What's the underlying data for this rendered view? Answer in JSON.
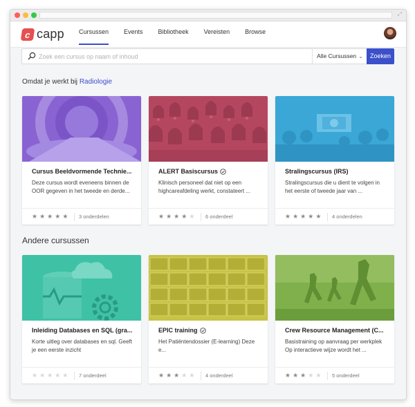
{
  "nav": {
    "logo_letter": "c",
    "logo_text": "capp",
    "items": [
      {
        "label": "Cursussen",
        "active": true
      },
      {
        "label": "Events",
        "active": false
      },
      {
        "label": "Bibliotheek",
        "active": false
      },
      {
        "label": "Vereisten",
        "active": false
      },
      {
        "label": "Browse",
        "active": false
      }
    ]
  },
  "search": {
    "placeholder": "Zoek een cursus op naam of inhoud",
    "value": "",
    "filter_label": "Alle Cursussen",
    "button_label": "Zoeken"
  },
  "sections": {
    "recommended_prefix": "Omdat je werkt bij",
    "recommended_link": "Radiologie",
    "other_title": "Andere cursussen"
  },
  "colors": {
    "accent": "#3b4bcc",
    "brand": "#e6504f"
  },
  "courses": [
    {
      "title": "Cursus Beeldvormende Technie...",
      "verified": false,
      "desc": "Deze cursus wordt eveneens binnen de OOR gegeven in het tweede en derde...",
      "rating": 5,
      "count": "3 onderdelen",
      "image": "mri-scanner",
      "tint": "#8a63d2"
    },
    {
      "title": "ALERT Basiscursus",
      "verified": true,
      "desc": "Klinisch personeel dat niet op een highcareafdeling werkt, constateert ...",
      "rating": 4,
      "count": "6 onderdeel",
      "image": "bells",
      "tint": "#b4475f"
    },
    {
      "title": "Stralingscursus (IRS)",
      "verified": false,
      "desc": "Stralingscursus die u dient te volgen in het eerste of tweede jaar van ...",
      "rating": 5,
      "count": "4 onderdelen",
      "image": "sign-crowd",
      "tint": "#3aa7d6"
    },
    {
      "title": "Inleiding Databases en SQL (gra...",
      "verified": false,
      "desc": "Korte uitleg over databases en sql. Geeft je een eerste inzicht",
      "rating": 0,
      "count": "7 onderdeel",
      "image": "database-cloud",
      "tint": "#3fc1a6"
    },
    {
      "title": "EPIC training",
      "verified": true,
      "desc": "Het Patiëntendossier (E-learning) Deze e...",
      "rating": 3,
      "count": "4 onderdeel",
      "image": "file-drawers",
      "tint": "#c7c346"
    },
    {
      "title": "Crew Resource Management (C...",
      "verified": false,
      "desc": "Basistraining op aanvraag per werkplek Op interactieve wijze wordt het ...",
      "rating": 3,
      "count": "5 onderdeel",
      "image": "runners",
      "tint": "#7fb04b"
    }
  ]
}
